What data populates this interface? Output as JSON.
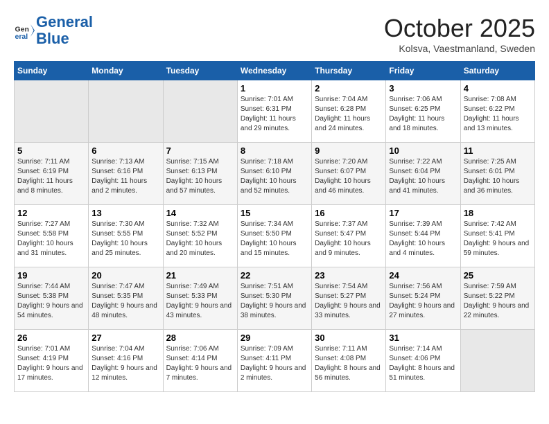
{
  "header": {
    "logo_line1": "General",
    "logo_line2": "Blue",
    "month": "October 2025",
    "location": "Kolsva, Vaestmanland, Sweden"
  },
  "weekdays": [
    "Sunday",
    "Monday",
    "Tuesday",
    "Wednesday",
    "Thursday",
    "Friday",
    "Saturday"
  ],
  "weeks": [
    [
      {
        "day": "",
        "sunrise": "",
        "sunset": "",
        "daylight": ""
      },
      {
        "day": "",
        "sunrise": "",
        "sunset": "",
        "daylight": ""
      },
      {
        "day": "",
        "sunrise": "",
        "sunset": "",
        "daylight": ""
      },
      {
        "day": "1",
        "sunrise": "Sunrise: 7:01 AM",
        "sunset": "Sunset: 6:31 PM",
        "daylight": "Daylight: 11 hours and 29 minutes."
      },
      {
        "day": "2",
        "sunrise": "Sunrise: 7:04 AM",
        "sunset": "Sunset: 6:28 PM",
        "daylight": "Daylight: 11 hours and 24 minutes."
      },
      {
        "day": "3",
        "sunrise": "Sunrise: 7:06 AM",
        "sunset": "Sunset: 6:25 PM",
        "daylight": "Daylight: 11 hours and 18 minutes."
      },
      {
        "day": "4",
        "sunrise": "Sunrise: 7:08 AM",
        "sunset": "Sunset: 6:22 PM",
        "daylight": "Daylight: 11 hours and 13 minutes."
      }
    ],
    [
      {
        "day": "5",
        "sunrise": "Sunrise: 7:11 AM",
        "sunset": "Sunset: 6:19 PM",
        "daylight": "Daylight: 11 hours and 8 minutes."
      },
      {
        "day": "6",
        "sunrise": "Sunrise: 7:13 AM",
        "sunset": "Sunset: 6:16 PM",
        "daylight": "Daylight: 11 hours and 2 minutes."
      },
      {
        "day": "7",
        "sunrise": "Sunrise: 7:15 AM",
        "sunset": "Sunset: 6:13 PM",
        "daylight": "Daylight: 10 hours and 57 minutes."
      },
      {
        "day": "8",
        "sunrise": "Sunrise: 7:18 AM",
        "sunset": "Sunset: 6:10 PM",
        "daylight": "Daylight: 10 hours and 52 minutes."
      },
      {
        "day": "9",
        "sunrise": "Sunrise: 7:20 AM",
        "sunset": "Sunset: 6:07 PM",
        "daylight": "Daylight: 10 hours and 46 minutes."
      },
      {
        "day": "10",
        "sunrise": "Sunrise: 7:22 AM",
        "sunset": "Sunset: 6:04 PM",
        "daylight": "Daylight: 10 hours and 41 minutes."
      },
      {
        "day": "11",
        "sunrise": "Sunrise: 7:25 AM",
        "sunset": "Sunset: 6:01 PM",
        "daylight": "Daylight: 10 hours and 36 minutes."
      }
    ],
    [
      {
        "day": "12",
        "sunrise": "Sunrise: 7:27 AM",
        "sunset": "Sunset: 5:58 PM",
        "daylight": "Daylight: 10 hours and 31 minutes."
      },
      {
        "day": "13",
        "sunrise": "Sunrise: 7:30 AM",
        "sunset": "Sunset: 5:55 PM",
        "daylight": "Daylight: 10 hours and 25 minutes."
      },
      {
        "day": "14",
        "sunrise": "Sunrise: 7:32 AM",
        "sunset": "Sunset: 5:52 PM",
        "daylight": "Daylight: 10 hours and 20 minutes."
      },
      {
        "day": "15",
        "sunrise": "Sunrise: 7:34 AM",
        "sunset": "Sunset: 5:50 PM",
        "daylight": "Daylight: 10 hours and 15 minutes."
      },
      {
        "day": "16",
        "sunrise": "Sunrise: 7:37 AM",
        "sunset": "Sunset: 5:47 PM",
        "daylight": "Daylight: 10 hours and 9 minutes."
      },
      {
        "day": "17",
        "sunrise": "Sunrise: 7:39 AM",
        "sunset": "Sunset: 5:44 PM",
        "daylight": "Daylight: 10 hours and 4 minutes."
      },
      {
        "day": "18",
        "sunrise": "Sunrise: 7:42 AM",
        "sunset": "Sunset: 5:41 PM",
        "daylight": "Daylight: 9 hours and 59 minutes."
      }
    ],
    [
      {
        "day": "19",
        "sunrise": "Sunrise: 7:44 AM",
        "sunset": "Sunset: 5:38 PM",
        "daylight": "Daylight: 9 hours and 54 minutes."
      },
      {
        "day": "20",
        "sunrise": "Sunrise: 7:47 AM",
        "sunset": "Sunset: 5:35 PM",
        "daylight": "Daylight: 9 hours and 48 minutes."
      },
      {
        "day": "21",
        "sunrise": "Sunrise: 7:49 AM",
        "sunset": "Sunset: 5:33 PM",
        "daylight": "Daylight: 9 hours and 43 minutes."
      },
      {
        "day": "22",
        "sunrise": "Sunrise: 7:51 AM",
        "sunset": "Sunset: 5:30 PM",
        "daylight": "Daylight: 9 hours and 38 minutes."
      },
      {
        "day": "23",
        "sunrise": "Sunrise: 7:54 AM",
        "sunset": "Sunset: 5:27 PM",
        "daylight": "Daylight: 9 hours and 33 minutes."
      },
      {
        "day": "24",
        "sunrise": "Sunrise: 7:56 AM",
        "sunset": "Sunset: 5:24 PM",
        "daylight": "Daylight: 9 hours and 27 minutes."
      },
      {
        "day": "25",
        "sunrise": "Sunrise: 7:59 AM",
        "sunset": "Sunset: 5:22 PM",
        "daylight": "Daylight: 9 hours and 22 minutes."
      }
    ],
    [
      {
        "day": "26",
        "sunrise": "Sunrise: 7:01 AM",
        "sunset": "Sunset: 4:19 PM",
        "daylight": "Daylight: 9 hours and 17 minutes."
      },
      {
        "day": "27",
        "sunrise": "Sunrise: 7:04 AM",
        "sunset": "Sunset: 4:16 PM",
        "daylight": "Daylight: 9 hours and 12 minutes."
      },
      {
        "day": "28",
        "sunrise": "Sunrise: 7:06 AM",
        "sunset": "Sunset: 4:14 PM",
        "daylight": "Daylight: 9 hours and 7 minutes."
      },
      {
        "day": "29",
        "sunrise": "Sunrise: 7:09 AM",
        "sunset": "Sunset: 4:11 PM",
        "daylight": "Daylight: 9 hours and 2 minutes."
      },
      {
        "day": "30",
        "sunrise": "Sunrise: 7:11 AM",
        "sunset": "Sunset: 4:08 PM",
        "daylight": "Daylight: 8 hours and 56 minutes."
      },
      {
        "day": "31",
        "sunrise": "Sunrise: 7:14 AM",
        "sunset": "Sunset: 4:06 PM",
        "daylight": "Daylight: 8 hours and 51 minutes."
      },
      {
        "day": "",
        "sunrise": "",
        "sunset": "",
        "daylight": ""
      }
    ]
  ]
}
